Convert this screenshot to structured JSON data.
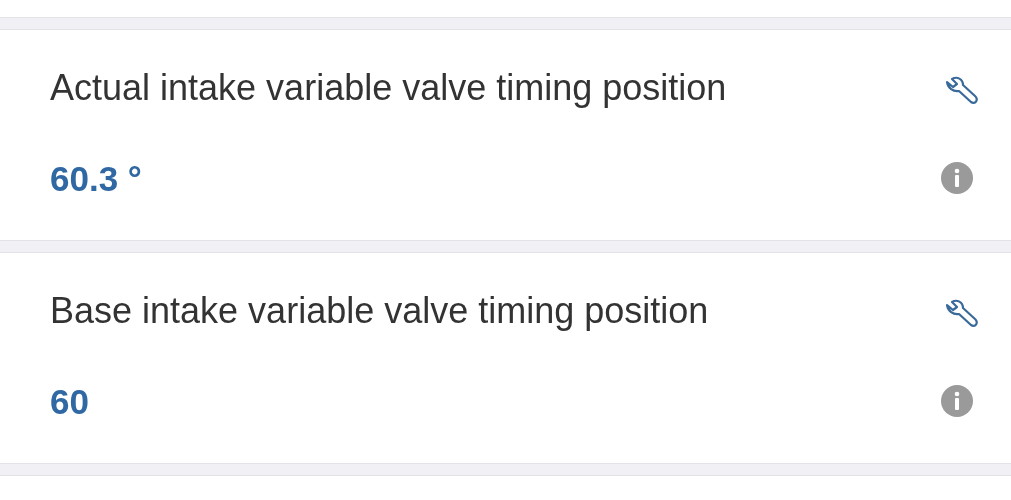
{
  "parameters": [
    {
      "name": "Actual intake variable valve timing position",
      "value": "60.3 °"
    },
    {
      "name": "Base intake variable valve timing position",
      "value": "60"
    }
  ]
}
